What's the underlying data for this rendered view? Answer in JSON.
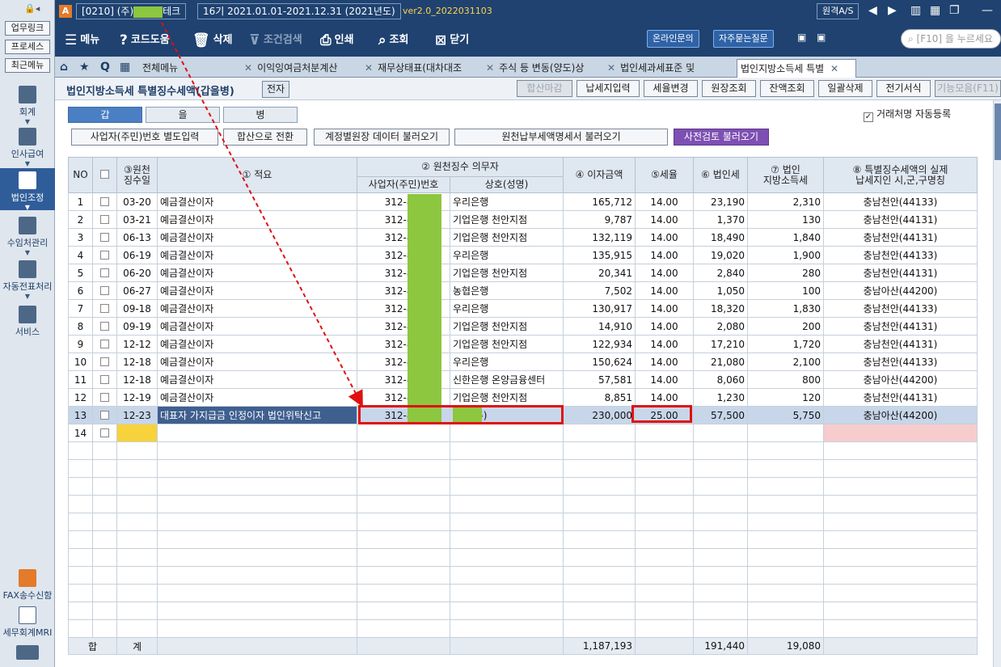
{
  "sidebar": {
    "quick_buttons": [
      "업무링크",
      "프로세스",
      "최근메뉴"
    ],
    "items": [
      {
        "label": "회계",
        "icon": "calculator-icon"
      },
      {
        "label": "인사급여",
        "icon": "person-coin-icon"
      },
      {
        "label": "법인조정",
        "icon": "building-icon",
        "active": true
      },
      {
        "label": "수임처관리",
        "icon": "client-management-icon"
      },
      {
        "label": "자동전표처리",
        "icon": "database-icon"
      },
      {
        "label": "서비스",
        "icon": "monitor-icon"
      }
    ],
    "bottom_items": [
      {
        "label": "FAX송수신함",
        "icon": "fax-icon"
      },
      {
        "label": "세무회계MRI",
        "icon": "waveform-icon"
      },
      {
        "label": "",
        "icon": "book-icon"
      }
    ]
  },
  "topbar": {
    "logo": "A",
    "company_prefix": "[0210]  (주)",
    "company_suffix": "테크",
    "period": "16기  2021.01.01-2021.12.31  (2021년도)",
    "version": "ver2.0_2022031103",
    "remote_as": "원격A/S"
  },
  "toolbar": {
    "menu": "메뉴",
    "code_help": "코드도움",
    "delete": "삭제",
    "condition_search": "조건검색",
    "print": "인쇄",
    "lookup": "조회",
    "close": "닫기",
    "online_inquiry": "온라인문의",
    "faq": "자주묻는질문",
    "search_placeholder": "[F10] 을 누르세요"
  },
  "tabs": {
    "menu_all": "전체메뉴",
    "items": [
      "이익잉여금처분계산",
      "재무상태표(대차대조",
      "주식 등 변동(양도)상",
      "법인세과세표준 및",
      "법인지방소득세 특별"
    ]
  },
  "page": {
    "title": "법인지방소득세 특별징수세액(갑을병)",
    "title_tag": "전자",
    "header_buttons": [
      "합산마감",
      "납세지입력",
      "세율변경",
      "원장조회",
      "잔액조회",
      "일괄삭제",
      "전기서식",
      "기능모음(F11)"
    ]
  },
  "panel": {
    "subtabs": [
      "갑",
      "을",
      "병"
    ],
    "auto_register_label": "거래처명 자동등록",
    "auto_register_checked": true,
    "action_buttons": [
      "사업자(주민)번호 별도입력",
      "합산으로 전환",
      "계정별원장 데이터 불러오기",
      "원천납부세액명세서 불러오기",
      "사전검토 불러오기"
    ]
  },
  "grid": {
    "headers": {
      "no": "NO",
      "date": "③원천\n징수일",
      "summary": "① 적요",
      "withholder": "② 원천징수 의무자",
      "biz_no": "사업자(주민)번호",
      "name": "상호(성명)",
      "interest": "④ 이자금액",
      "rate": "⑤세율",
      "corp_tax": "⑥ 법인세",
      "local_tax": "⑦ 법인\n지방소득세",
      "region": "⑧ 특별징수세액의 실제\n납세지인 시,군,구명칭"
    },
    "rows": [
      {
        "no": "1",
        "date": "03-20",
        "summary": "예금결산이자",
        "biz": "312-85-",
        "name": "우리은행",
        "interest": "165,712",
        "rate": "14.00",
        "corp": "23,190",
        "local": "2,310",
        "region": "충남천안(44133)"
      },
      {
        "no": "2",
        "date": "03-21",
        "summary": "예금결산이자",
        "biz": "312-85-",
        "name": "기업은행  천안지점",
        "interest": "9,787",
        "rate": "14.00",
        "corp": "1,370",
        "local": "130",
        "region": "충남천안(44131)"
      },
      {
        "no": "3",
        "date": "06-13",
        "summary": "예금결산이자",
        "biz": "312-85-",
        "name": "기업은행  천안지점",
        "interest": "132,119",
        "rate": "14.00",
        "corp": "18,490",
        "local": "1,840",
        "region": "충남천안(44131)"
      },
      {
        "no": "4",
        "date": "06-19",
        "summary": "예금결산이자",
        "biz": "312-85-",
        "name": "우리은행",
        "interest": "135,915",
        "rate": "14.00",
        "corp": "19,020",
        "local": "1,900",
        "region": "충남천안(44133)"
      },
      {
        "no": "5",
        "date": "06-20",
        "summary": "예금결산이자",
        "biz": "312-85-",
        "name": "기업은행  천안지점",
        "interest": "20,341",
        "rate": "14.00",
        "corp": "2,840",
        "local": "280",
        "region": "충남천안(44131)"
      },
      {
        "no": "6",
        "date": "06-27",
        "summary": "예금결산이자",
        "biz": "312-85-",
        "name": "농협은행",
        "interest": "7,502",
        "rate": "14.00",
        "corp": "1,050",
        "local": "100",
        "region": "충남아산(44200)"
      },
      {
        "no": "7",
        "date": "09-18",
        "summary": "예금결산이자",
        "biz": "312-85-",
        "name": "우리은행",
        "interest": "130,917",
        "rate": "14.00",
        "corp": "18,320",
        "local": "1,830",
        "region": "충남천안(44133)"
      },
      {
        "no": "8",
        "date": "09-19",
        "summary": "예금결산이자",
        "biz": "312-85-",
        "name": "기업은행  천안지점",
        "interest": "14,910",
        "rate": "14.00",
        "corp": "2,080",
        "local": "200",
        "region": "충남천안(44131)"
      },
      {
        "no": "9",
        "date": "12-12",
        "summary": "예금결산이자",
        "biz": "312-85-",
        "name": "기업은행  천안지점",
        "interest": "122,934",
        "rate": "14.00",
        "corp": "17,210",
        "local": "1,720",
        "region": "충남천안(44131)"
      },
      {
        "no": "10",
        "date": "12-18",
        "summary": "예금결산이자",
        "biz": "312-85-",
        "name": "우리은행",
        "interest": "150,624",
        "rate": "14.00",
        "corp": "21,080",
        "local": "2,100",
        "region": "충남천안(44133)"
      },
      {
        "no": "11",
        "date": "12-18",
        "summary": "예금결산이자",
        "biz": "312-85-",
        "name": "신한은행  온양금융센터",
        "interest": "57,581",
        "rate": "14.00",
        "corp": "8,060",
        "local": "800",
        "region": "충남아산(44200)"
      },
      {
        "no": "12",
        "date": "12-19",
        "summary": "예금결산이자",
        "biz": "312-85-",
        "name": "기업은행  천안지점",
        "interest": "8,851",
        "rate": "14.00",
        "corp": "1,230",
        "local": "120",
        "region": "충남천안(44131)"
      },
      {
        "no": "13",
        "date": "12-23",
        "summary": "대표자 가지급금 인정이자 법인위탁신고",
        "biz": "312-81-",
        "name": "테크(주)",
        "interest": "230,000",
        "rate": "25.00",
        "corp": "57,500",
        "local": "5,750",
        "region": "충남아산(44200)",
        "selected": true
      },
      {
        "no": "14",
        "date": "",
        "summary": "",
        "biz": "",
        "name": "",
        "interest": "",
        "rate": "",
        "corp": "",
        "local": "",
        "region": "",
        "new": true
      }
    ],
    "total": {
      "label1": "합",
      "label2": "계",
      "interest": "1,187,193",
      "corp": "191,440",
      "local": "19,080"
    }
  }
}
